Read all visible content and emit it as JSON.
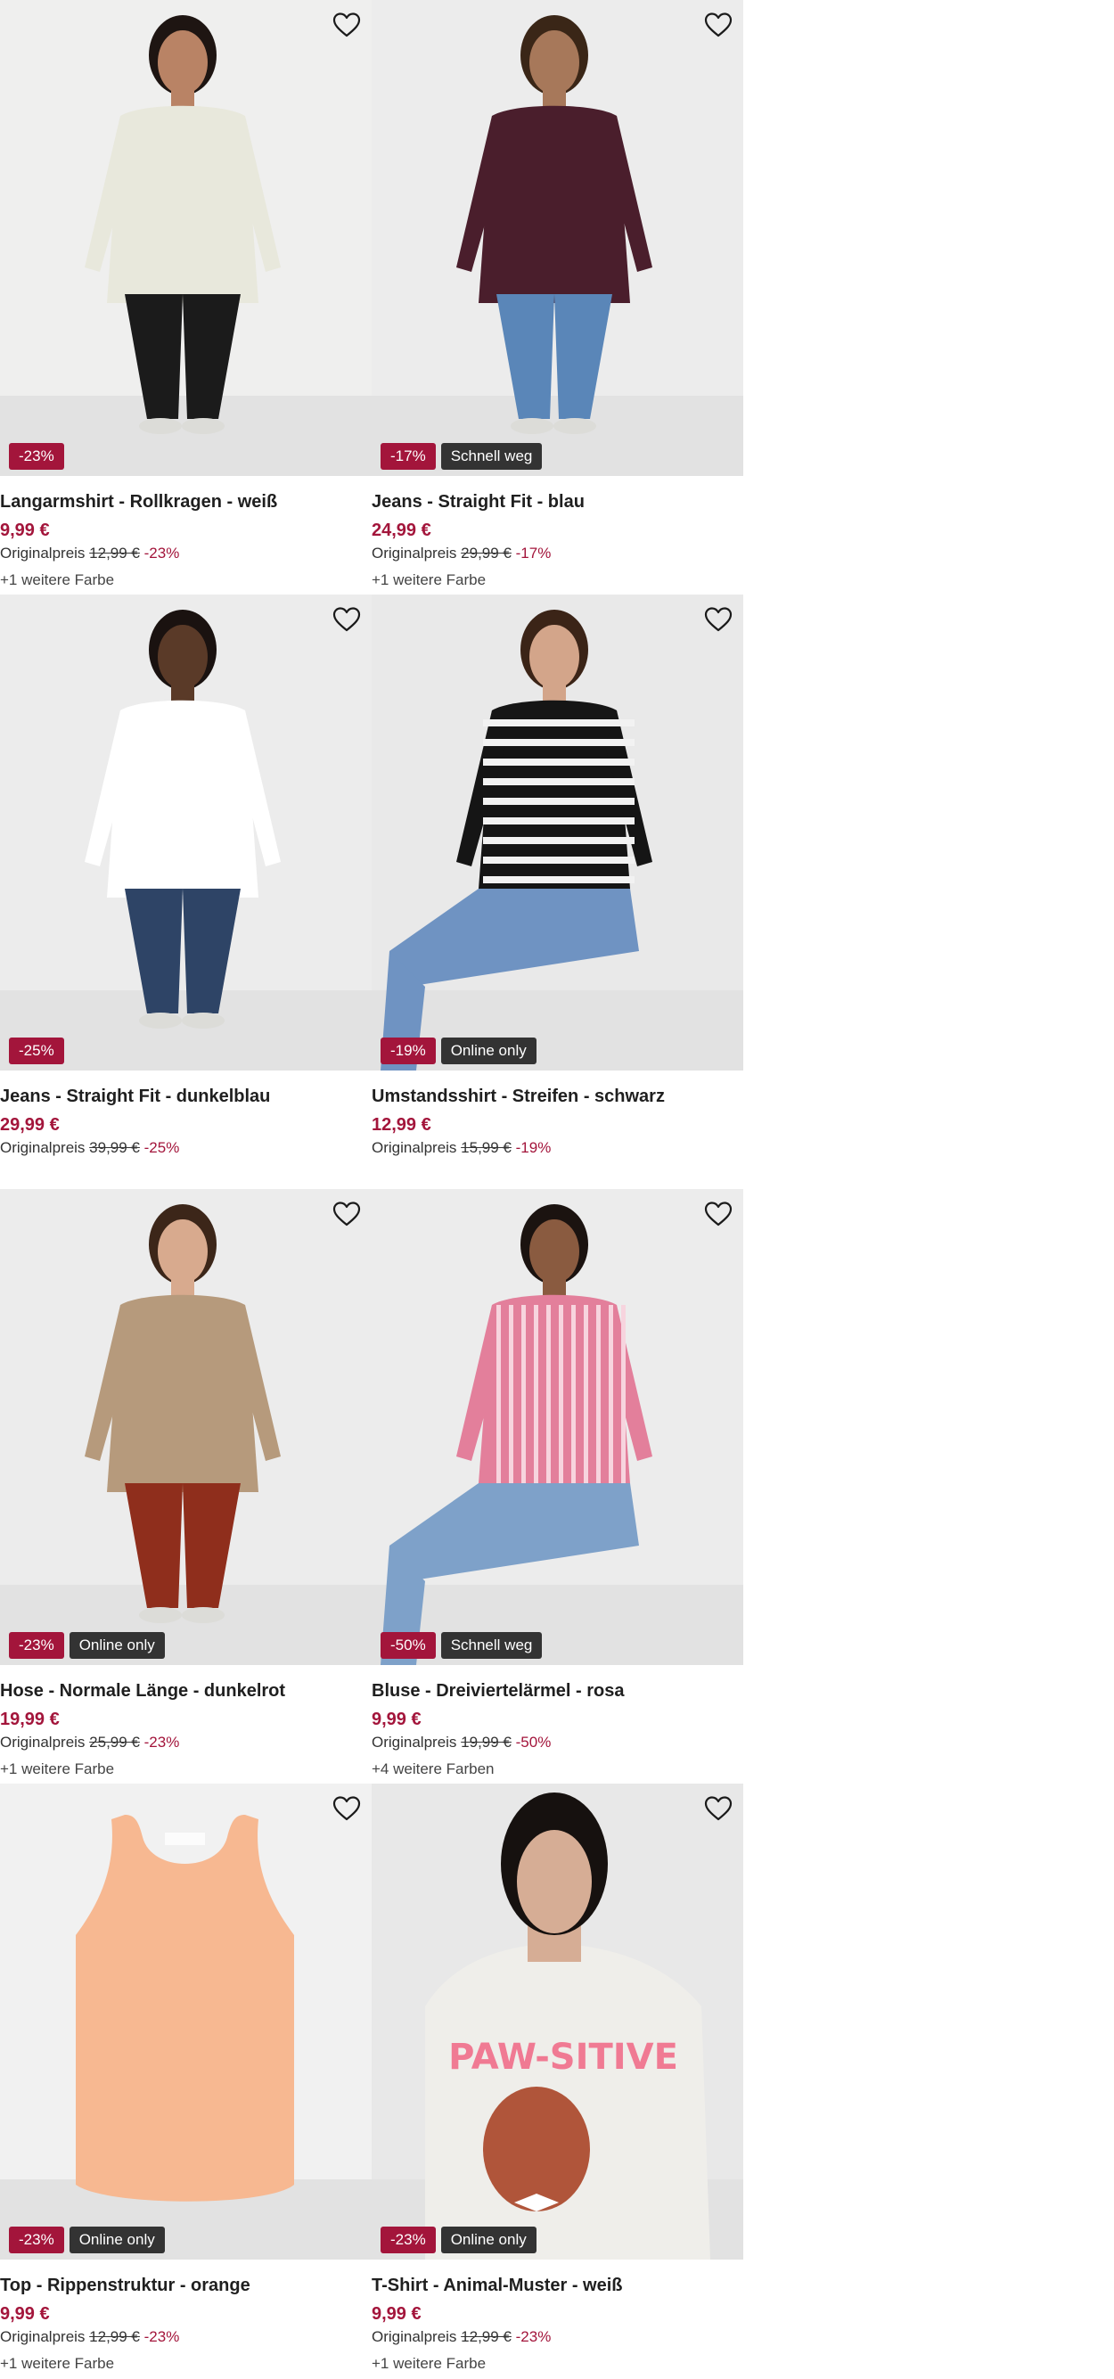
{
  "products": [
    {
      "title": "Langarmshirt - Rollkragen - weiß",
      "price": "9,99 €",
      "orig_label": "Originalpreis",
      "orig_price": "12,99 €",
      "discount": "-23%",
      "badge": "",
      "colors": "+1 weitere Farbe",
      "palette": {
        "bg": "#efefee",
        "top": "#e8e8dc",
        "bottom": "#1b1b1b",
        "skin": "#b98365",
        "hair": "#1e1512"
      }
    },
    {
      "title": "Jeans - Straight Fit - blau",
      "price": "24,99 €",
      "orig_label": "Originalpreis",
      "orig_price": "29,99 €",
      "discount": "-17%",
      "badge": "Schnell weg",
      "colors": "+1 weitere Farbe",
      "palette": {
        "bg": "#ececec",
        "top": "#4a1e2c",
        "bottom": "#5a86b8",
        "skin": "#a7785a",
        "hair": "#3a2617"
      }
    },
    {
      "title": "Jeans - Straight Fit - dunkelblau",
      "price": "29,99 €",
      "orig_label": "Originalpreis",
      "orig_price": "39,99 €",
      "discount": "-25%",
      "badge": "",
      "colors": "",
      "palette": {
        "bg": "#ececec",
        "top": "#ffffff",
        "bottom": "#2e4466",
        "skin": "#5a3a28",
        "hair": "#1a1210"
      }
    },
    {
      "title": "Umstandsshirt - Streifen - schwarz",
      "price": "12,99 €",
      "orig_label": "Originalpreis",
      "orig_price": "15,99 €",
      "discount": "-19%",
      "badge": "Online only",
      "colors": "",
      "palette": {
        "bg": "#e9e9e9",
        "top": "#151515",
        "bottom": "#6f93c2",
        "skin": "#d3a58a",
        "hair": "#3b2417"
      }
    },
    {
      "title": "Hose - Normale Länge - dunkelrot",
      "price": "19,99 €",
      "orig_label": "Originalpreis",
      "orig_price": "25,99 €",
      "discount": "-23%",
      "badge": "Online only",
      "colors": "+1 weitere Farbe",
      "palette": {
        "bg": "#ececec",
        "top": "#b69a7c",
        "bottom": "#8f2e1c",
        "skin": "#d8aa8e",
        "hair": "#3c2619"
      }
    },
    {
      "title": "Bluse - Dreiviertelärmel - rosa",
      "price": "9,99 €",
      "orig_label": "Originalpreis",
      "orig_price": "19,99 €",
      "discount": "-50%",
      "badge": "Schnell weg",
      "colors": "+4 weitere Farben",
      "palette": {
        "bg": "#ececec",
        "top": "#e37f9b",
        "bottom": "#7ea1c9",
        "skin": "#8a5b40",
        "hair": "#1b1310"
      }
    },
    {
      "title": "Top - Rippenstruktur - orange",
      "price": "9,99 €",
      "orig_label": "Originalpreis",
      "orig_price": "12,99 €",
      "discount": "-23%",
      "badge": "Online only",
      "colors": "+1 weitere Farbe",
      "palette": {
        "bg": "#f1f1f1",
        "top": "#f7b891",
        "bottom": "",
        "skin": "",
        "hair": ""
      }
    },
    {
      "title": "T-Shirt - Animal-Muster - weiß",
      "price": "9,99 €",
      "orig_label": "Originalpreis",
      "orig_price": "12,99 €",
      "discount": "-23%",
      "badge": "Online only",
      "colors": "+1 weitere Farbe",
      "palette": {
        "bg": "#e8e8e8",
        "top": "#efeeea",
        "bottom": "",
        "skin": "#d6ad95",
        "hair": "#16110f"
      }
    }
  ],
  "icons": {
    "favorite": "heart-outline-icon"
  },
  "colors": {
    "accent": "#a3153b",
    "label_bg": "#333333"
  }
}
